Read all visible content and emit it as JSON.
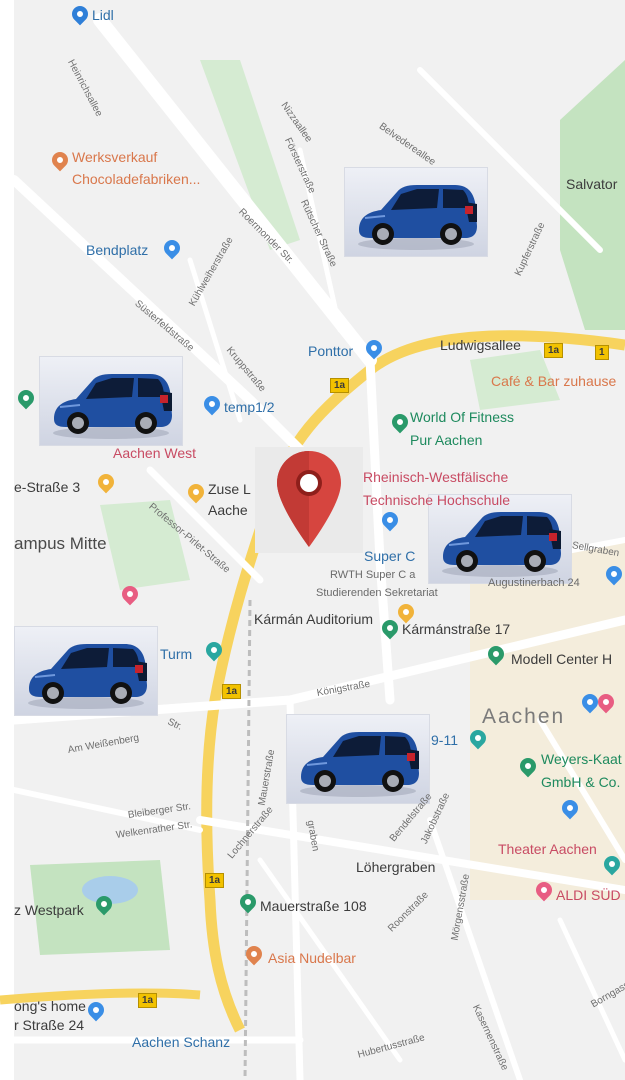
{
  "map": {
    "place_labels": [
      {
        "id": "lidl",
        "text": "Lidl",
        "cls": "blue"
      },
      {
        "id": "werksverkauf",
        "text": "Werksverkauf",
        "cls": "orange"
      },
      {
        "id": "chocolade",
        "text": "Chocoladefabriken...",
        "cls": "orange"
      },
      {
        "id": "bendplatz",
        "text": "Bendplatz",
        "cls": "blue"
      },
      {
        "id": "salvator",
        "text": "Salvator",
        "cls": "dark"
      },
      {
        "id": "ponttor",
        "text": "Ponttor",
        "cls": "blue"
      },
      {
        "id": "ludwigsallee",
        "text": "Ludwigsallee",
        "cls": "dark"
      },
      {
        "id": "cafe",
        "text": "Café & Bar zuhause",
        "cls": "orange"
      },
      {
        "id": "worldfitness1",
        "text": "World Of Fitness",
        "cls": "green"
      },
      {
        "id": "worldfitness2",
        "text": "Pur Aachen",
        "cls": "green"
      },
      {
        "id": "temp",
        "text": "temp1/2",
        "cls": "blue"
      },
      {
        "id": "aachenwest",
        "text": "Aachen West",
        "cls": "red"
      },
      {
        "id": "rwth1",
        "text": "Rheinisch-Westfälische",
        "cls": "red"
      },
      {
        "id": "rwth2",
        "text": "Technische Hochschule",
        "cls": "red"
      },
      {
        "id": "strasse3",
        "text": "e-Straße 3",
        "cls": "dark"
      },
      {
        "id": "zuse1",
        "text": "Zuse L",
        "cls": "dark"
      },
      {
        "id": "zuse2",
        "text": "Aache",
        "cls": "dark"
      },
      {
        "id": "campus",
        "text": "ampus Mitte",
        "cls": "mid"
      },
      {
        "id": "superc",
        "text": "Super C",
        "cls": "blue"
      },
      {
        "id": "rwthsuperc",
        "text": "RWTH Super C a",
        "cls": "small"
      },
      {
        "id": "sekretariat",
        "text": "Studierenden Sekretariat",
        "cls": "small"
      },
      {
        "id": "karman",
        "text": "Kármán Auditorium",
        "cls": "dark"
      },
      {
        "id": "karmanstr",
        "text": "Kármánstraße 17",
        "cls": "dark"
      },
      {
        "id": "augustiner",
        "text": "Augustinerbach 24",
        "cls": "small"
      },
      {
        "id": "modell",
        "text": "Modell Center H",
        "cls": "dark"
      },
      {
        "id": "turm",
        "text": "Turm",
        "cls": "blue"
      },
      {
        "id": "aachen",
        "text": "Aachen",
        "cls": "big"
      },
      {
        "id": "nine11",
        "text": "9-11",
        "cls": "blue"
      },
      {
        "id": "weyers1",
        "text": "Weyers-Kaat",
        "cls": "green"
      },
      {
        "id": "weyers2",
        "text": "GmbH & Co.",
        "cls": "green"
      },
      {
        "id": "theater",
        "text": "Theater Aachen",
        "cls": "red"
      },
      {
        "id": "aldi",
        "text": "ALDI SÜD",
        "cls": "red"
      },
      {
        "id": "westpark",
        "text": "z Westpark",
        "cls": "dark"
      },
      {
        "id": "mauerstr108",
        "text": "Mauerstraße 108",
        "cls": "dark"
      },
      {
        "id": "asianudel",
        "text": "Asia Nudelbar",
        "cls": "orange"
      },
      {
        "id": "songs1",
        "text": "ong's home",
        "cls": "dark"
      },
      {
        "id": "songs2",
        "text": "r Straße 24",
        "cls": "dark"
      },
      {
        "id": "schanz",
        "text": "Aachen Schanz",
        "cls": "blue"
      },
      {
        "id": "lohergraben",
        "text": "Löhergraben",
        "cls": "dark"
      }
    ],
    "street_labels": [
      {
        "id": "heinrichsallee",
        "text": "Heinrichsallee"
      },
      {
        "id": "nizzaallee",
        "text": "Nizzaallee"
      },
      {
        "id": "forsterstrasse",
        "text": "Försterstraße"
      },
      {
        "id": "belvedereallee",
        "text": "Belvedereallee"
      },
      {
        "id": "roermonder",
        "text": "Roermonder Str."
      },
      {
        "id": "rutscher",
        "text": "Rütscher Straße"
      },
      {
        "id": "kupferstrasse",
        "text": "Kupferstraße"
      },
      {
        "id": "susterfeld",
        "text": "Süsterfeldstraße"
      },
      {
        "id": "kohlweiher",
        "text": "Kühlweiherstraße"
      },
      {
        "id": "kruppstrasse",
        "text": "Kruppstraße"
      },
      {
        "id": "professorpirlet",
        "text": "Professor-Pirlet-Straße"
      },
      {
        "id": "sellgraben",
        "text": "Sellgraben"
      },
      {
        "id": "konigstrasse",
        "text": "Königstraße"
      },
      {
        "id": "amweissenberg",
        "text": "Am Weißenberg"
      },
      {
        "id": "mauerstrasse",
        "text": "Mauerstraße"
      },
      {
        "id": "bleiberger",
        "text": "Bleiberger Str."
      },
      {
        "id": "welkenrather",
        "text": "Welkenrather Str."
      },
      {
        "id": "lochnerstrasse",
        "text": "Lochnerstraße"
      },
      {
        "id": "roonstrasse",
        "text": "Roonstraße"
      },
      {
        "id": "monheimsallee",
        "text": "Mörgensstraße"
      },
      {
        "id": "bendelstrasse",
        "text": "Bendelstraße"
      },
      {
        "id": "jakobstrasse",
        "text": "Jakobstraße"
      },
      {
        "id": "kasernenstrasse",
        "text": "Kasernenstraße"
      },
      {
        "id": "hubertusstrasse",
        "text": "Hubertusstraße"
      },
      {
        "id": "bornstrasse",
        "text": "Borngasse"
      },
      {
        "id": "boxgraben",
        "text": "graben"
      },
      {
        "id": "strstr",
        "text": "Str."
      }
    ],
    "route_shields": [
      "1a",
      "1a",
      "1a",
      "1a",
      "1a",
      "1"
    ],
    "cars": [
      "car",
      "car",
      "car",
      "car",
      "car",
      "car"
    ],
    "selected_marker": "location-pin-icon",
    "colors": {
      "background": "#f1f1f1",
      "road": "#ffffff",
      "major_road": "#f7d35e",
      "park": "#c4e3c0",
      "water": "#a9cdea",
      "building": "#e6e6e6",
      "marker": "#d6453f",
      "car_body": "#1f4fa1"
    }
  }
}
